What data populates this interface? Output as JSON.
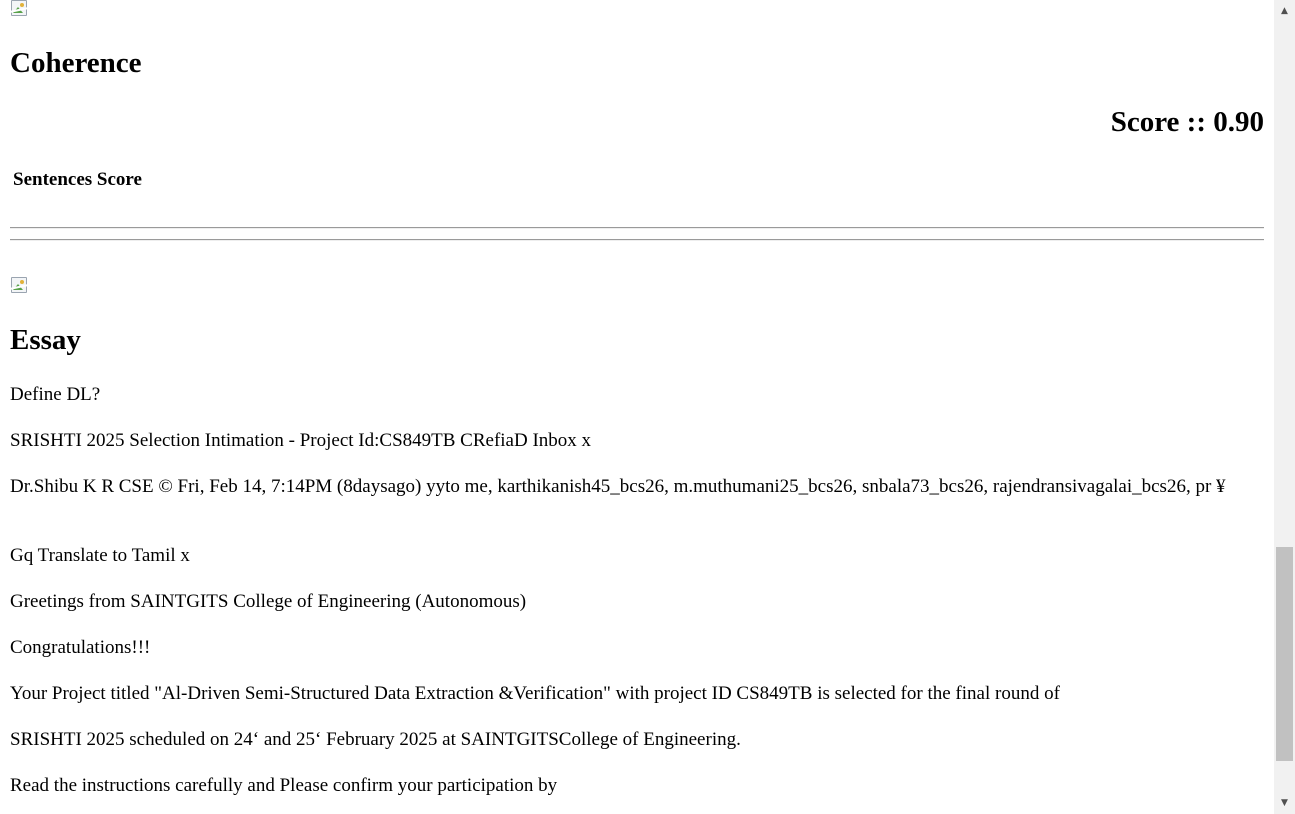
{
  "sections": {
    "coherence": {
      "title": "Coherence",
      "score": "Score :: 0.90",
      "sentences_header": "Sentences Score"
    },
    "essay": {
      "title": "Essay",
      "paragraphs": [
        "Define DL?",
        "SRISHTI 2025 Selection Intimation - Project Id:CS849TB CRefiaD Inbox x",
        "Dr.Shibu K R CSE © Fri, Feb 14, 7:14PM (8daysago) yyto me, karthikanish45_bcs26, m.muthumani25_bcs26, snbala73_bcs26, rajendransivagalai_bcs26, pr ¥",
        "Gq Translate to Tamil x",
        "Greetings from SAINTGITS College of Engineering (Autonomous)",
        "Congratulations!!!",
        "Your Project titled \"Al-Driven Semi-Structured Data Extraction &Verification\" with project ID CS849TB is selected for the final round of",
        "SRISHTI 2025 scheduled on 24‘ and 25‘ February 2025 at SAINTGITSCollege of Engineering.",
        "Read the instructions carefully and Please confirm your participation by"
      ]
    }
  },
  "icons": {
    "image": "broken-image-icon",
    "scroll_up": "scroll-up-arrow-icon",
    "scroll_down": "scroll-down-arrow-icon"
  },
  "scrollbar": {
    "glyph_up": "▲",
    "glyph_down": "▼"
  }
}
